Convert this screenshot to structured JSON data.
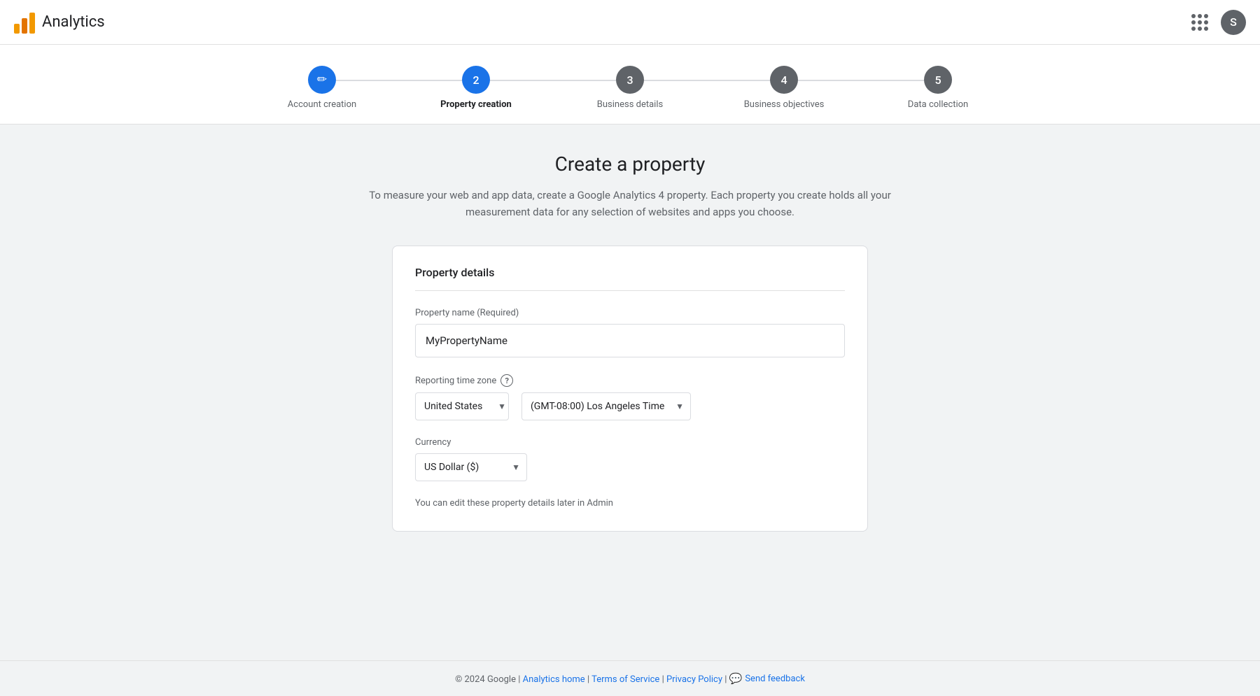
{
  "header": {
    "title": "Analytics",
    "avatar_letter": "S"
  },
  "stepper": {
    "steps": [
      {
        "id": "account-creation",
        "label": "Account creation",
        "state": "completed",
        "number": "✏",
        "is_pencil": true
      },
      {
        "id": "property-creation",
        "label": "Property creation",
        "state": "active",
        "number": "2"
      },
      {
        "id": "business-details",
        "label": "Business details",
        "state": "inactive",
        "number": "3"
      },
      {
        "id": "business-objectives",
        "label": "Business objectives",
        "state": "inactive",
        "number": "4"
      },
      {
        "id": "data-collection",
        "label": "Data collection",
        "state": "inactive",
        "number": "5"
      }
    ]
  },
  "page": {
    "heading": "Create a property",
    "description": "To measure your web and app data, create a Google Analytics 4 property. Each property you create holds all your measurement data for any selection of websites and apps you choose."
  },
  "form": {
    "card_title": "Property details",
    "property_name_label": "Property name (Required)",
    "property_name_value": "MyPropertyName",
    "property_name_placeholder": "MyPropertyName",
    "timezone_label": "Reporting time zone",
    "country_value": "United States",
    "timezone_value": "(GMT-08:00) Los Angeles Time",
    "currency_label": "Currency",
    "currency_value": "US Dollar ($)",
    "edit_note": "You can edit these property details later in Admin"
  },
  "footer": {
    "copyright": "© 2024 Google",
    "separator": "|",
    "analytics_home_label": "Analytics home",
    "terms_label": "Terms of Service",
    "privacy_label": "Privacy Policy",
    "feedback_label": "Send feedback"
  }
}
